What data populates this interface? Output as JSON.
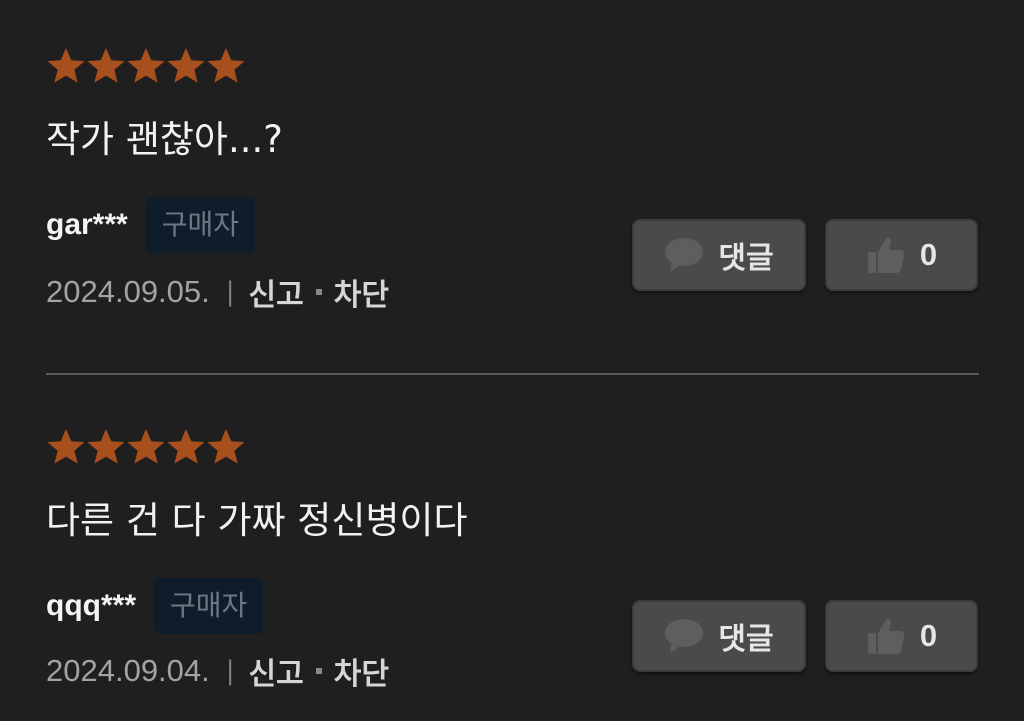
{
  "colors": {
    "background": "#1f1f1f",
    "star": "#a84f1e",
    "badge_bg": "#0f1c2a",
    "badge_text": "#6d7784",
    "button_bg": "#4a4a4a"
  },
  "reviews": [
    {
      "rating": 5,
      "text": "작가 괜찮아...?",
      "username": "gar***",
      "badge": "구매자",
      "date": "2024.09.05.",
      "separator": "|",
      "report_label": "신고",
      "block_label": "차단",
      "comment_label": "댓글",
      "comment_icon": "speech-bubble-icon",
      "like_icon": "thumbs-up-icon",
      "like_count": "0"
    },
    {
      "rating": 5,
      "text": "다른 건 다 가짜 정신병이다",
      "username": "qqq***",
      "badge": "구매자",
      "date": "2024.09.04.",
      "separator": "|",
      "report_label": "신고",
      "block_label": "차단",
      "comment_label": "댓글",
      "comment_icon": "speech-bubble-icon",
      "like_icon": "thumbs-up-icon",
      "like_count": "0"
    }
  ]
}
